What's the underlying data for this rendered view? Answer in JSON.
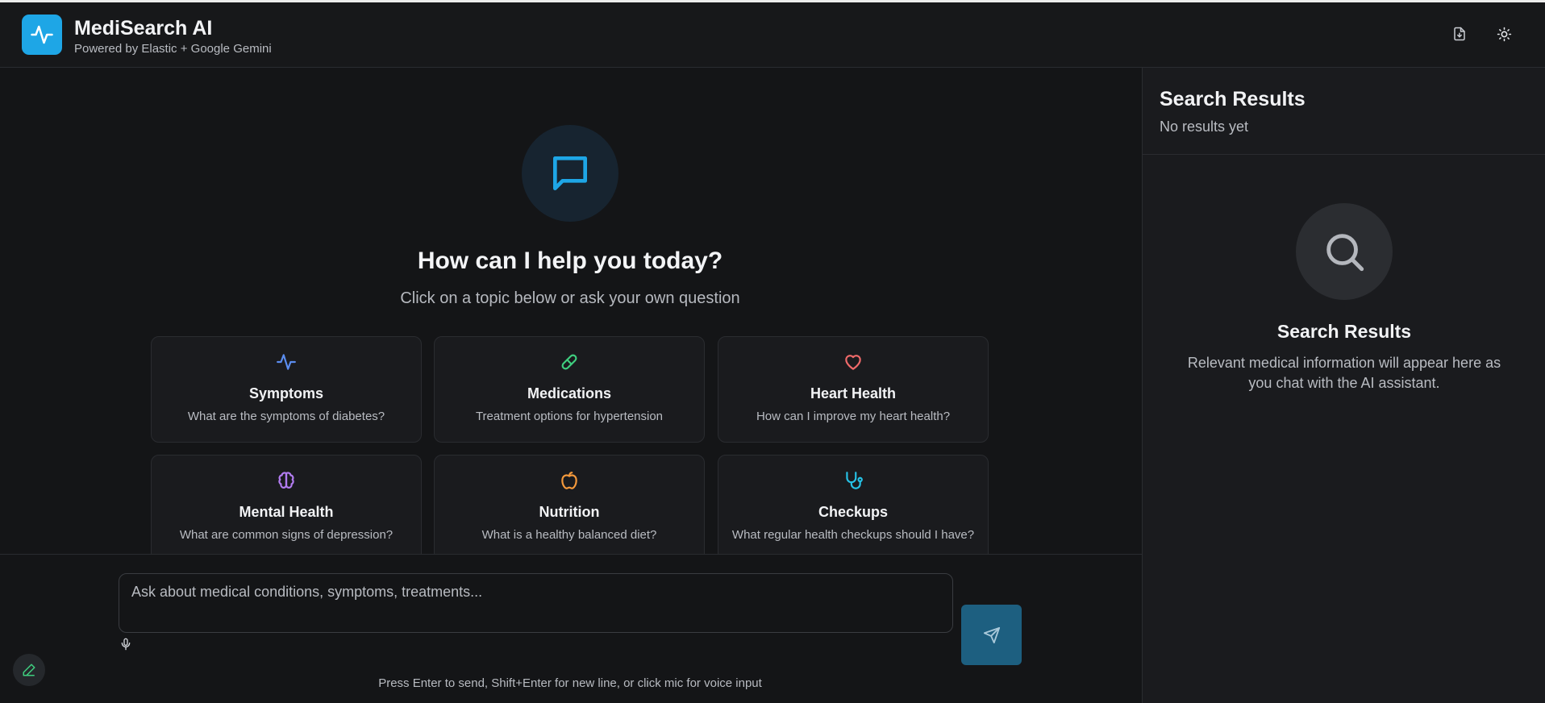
{
  "header": {
    "title": "MediSearch AI",
    "subtitle": "Powered by Elastic + Google Gemini",
    "logo_icon": "activity-pulse-icon",
    "actions": [
      {
        "icon": "file-download-icon"
      },
      {
        "icon": "sun-icon"
      }
    ]
  },
  "welcome": {
    "icon": "chat-bubble-icon",
    "title": "How can I help you today?",
    "subtitle": "Click on a topic below or ask your own question"
  },
  "topics": [
    {
      "title": "Symptoms",
      "question": "What are the symptoms of diabetes?",
      "icon": "activity-pulse-icon",
      "color": "#5b8def"
    },
    {
      "title": "Medications",
      "question": "Treatment options for hypertension",
      "icon": "pill-icon",
      "color": "#3fcf7f"
    },
    {
      "title": "Heart Health",
      "question": "How can I improve my heart health?",
      "icon": "heart-icon",
      "color": "#f06a6a"
    },
    {
      "title": "Mental Health",
      "question": "What are common signs of depression?",
      "icon": "brain-icon",
      "color": "#b27cf0"
    },
    {
      "title": "Nutrition",
      "question": "What is a healthy balanced diet?",
      "icon": "apple-icon",
      "color": "#f59a3c"
    },
    {
      "title": "Checkups",
      "question": "What regular health checkups should I have?",
      "icon": "stethoscope-icon",
      "color": "#26c2e6"
    }
  ],
  "composer": {
    "placeholder": "Ask about medical conditions, symptoms, treatments...",
    "hint": "Press Enter to send, Shift+Enter for new line, or click mic for voice input",
    "mic_icon": "microphone-icon",
    "send_icon": "send-icon"
  },
  "results_panel": {
    "title": "Search Results",
    "status": "No results yet",
    "empty_icon": "search-icon",
    "empty_title": "Search Results",
    "empty_description": "Relevant medical information will appear here as you chat with the AI assistant."
  },
  "colors": {
    "accent": "#1ea6e6",
    "background": "#141517",
    "panel": "#1a1b1e"
  }
}
